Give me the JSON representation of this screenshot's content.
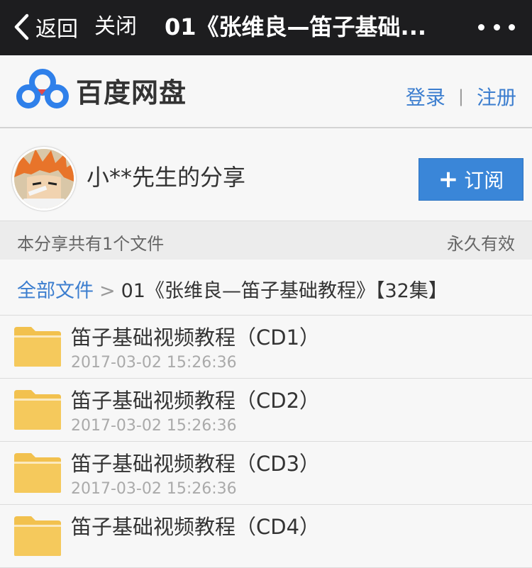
{
  "navbar": {
    "back_label": "返回",
    "close_label": "关闭",
    "title": "01《张维良—笛子基础..."
  },
  "header": {
    "brand": "百度网盘",
    "login_label": "登录",
    "separator": "|",
    "register_label": "注册"
  },
  "owner": {
    "name": "小**先生的分享",
    "subscribe_icon": "+",
    "subscribe_label": "订阅"
  },
  "info": {
    "file_count_text": "本分享共有1个文件",
    "validity": "永久有效"
  },
  "breadcrumb": {
    "root": "全部文件",
    "separator": ">",
    "current": "01《张维良—笛子基础教程》【32集】"
  },
  "files": [
    {
      "name": "笛子基础视频教程（CD1）",
      "date": "2017-03-02 15:26:36",
      "icon": "folder-icon"
    },
    {
      "name": "笛子基础视频教程（CD2）",
      "date": "2017-03-02 15:26:36",
      "icon": "folder-icon"
    },
    {
      "name": "笛子基础视频教程（CD3）",
      "date": "2017-03-02 15:26:36",
      "icon": "folder-icon"
    },
    {
      "name": "笛子基础视频教程（CD4）",
      "date": "",
      "icon": "folder-icon"
    }
  ],
  "colors": {
    "navbar_bg": "#1d1d1f",
    "link": "#3c7ecf",
    "subscribe_bg": "#3a86d8",
    "folder": "#f2c14e"
  }
}
